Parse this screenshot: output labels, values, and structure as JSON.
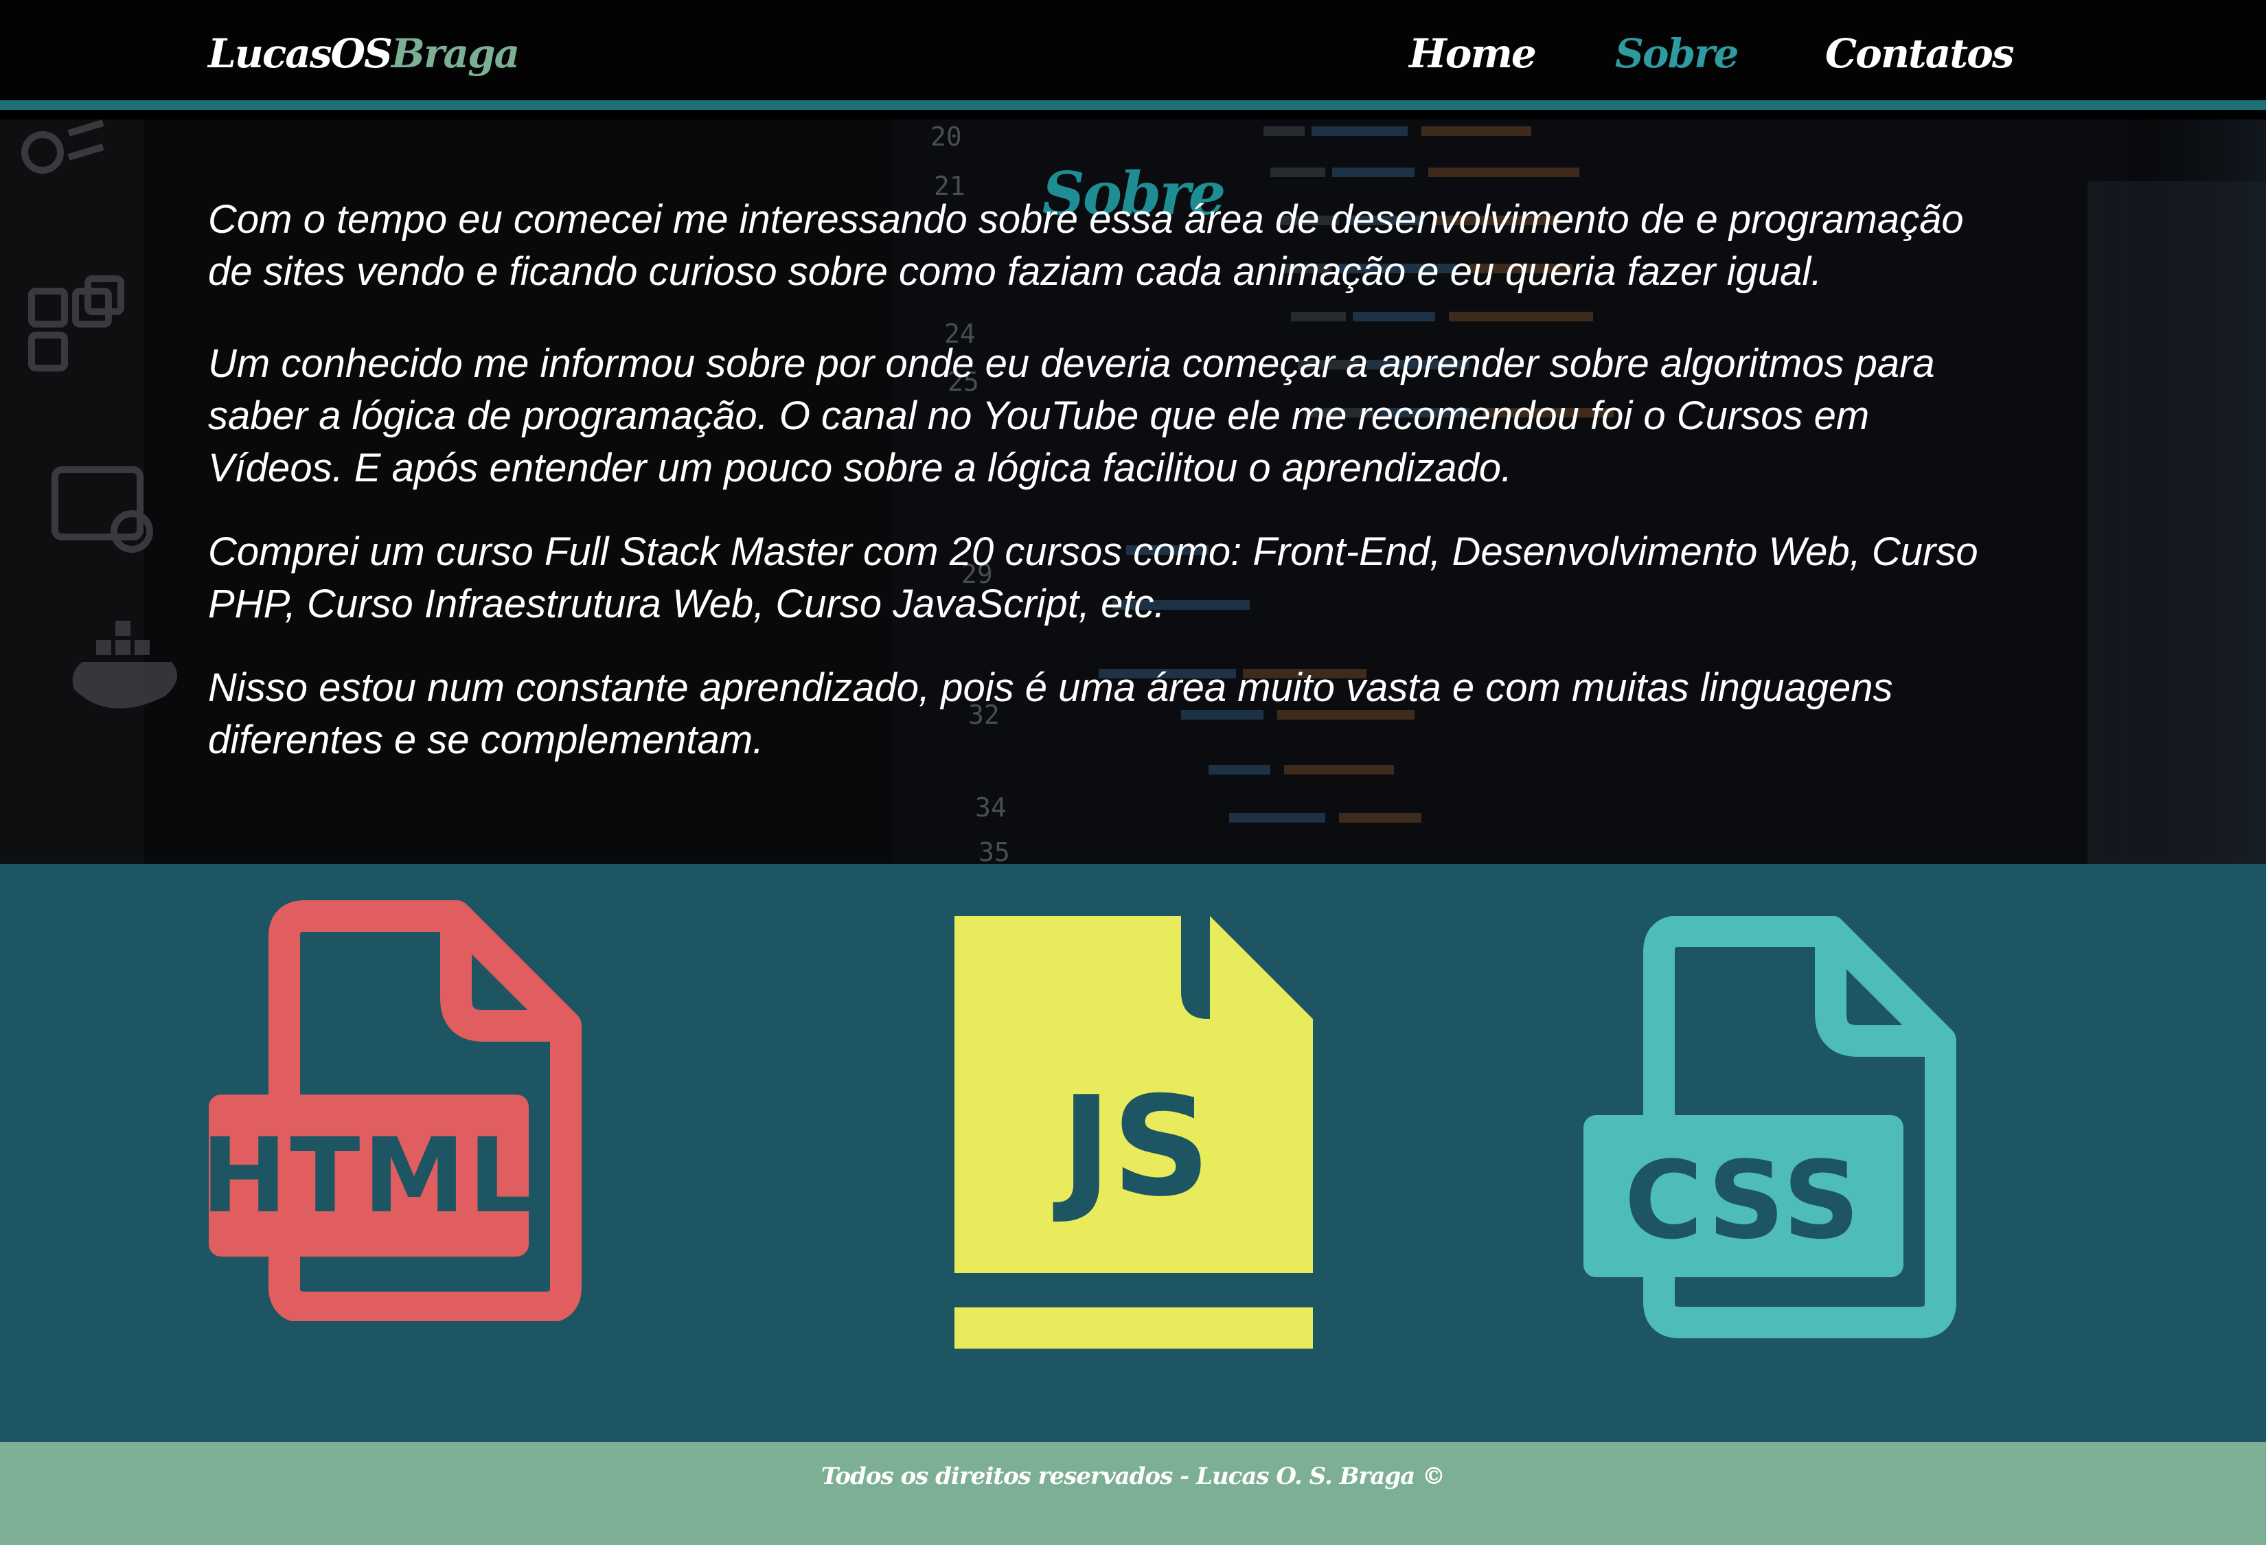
{
  "header": {
    "logo_main": "LucasOS",
    "logo_accent": "Braga",
    "nav": [
      {
        "label": "Home",
        "active": false
      },
      {
        "label": "Sobre",
        "active": true
      },
      {
        "label": "Contatos",
        "active": false
      }
    ]
  },
  "about": {
    "title": "Sobre",
    "paragraphs": [
      "Com o tempo eu comecei me interessando sobre essa área de desenvolvimento de e programação de sites vendo e ficando curioso sobre como faziam cada animação e eu queria fazer igual.",
      "Um conhecido me informou sobre por onde eu deveria começar a aprender sobre algoritmos para saber a lógica de programação. O canal no YouTube que ele me recomendou foi o Cursos em Vídeos. E após entender um pouco sobre a lógica facilitou o aprendizado.",
      "Comprei um curso Full Stack Master com 20 cursos como: Front-End, Desenvolvimento Web, Curso PHP, Curso Infraestrutura Web, Curso JavaScript, etc.",
      "Nisso estou num constante aprendizado, pois é uma área muito vasta e com muitas linguagens diferentes e se complementam."
    ],
    "background_line_numbers": [
      "20",
      "21",
      "24",
      "25",
      "29",
      "32",
      "34",
      "35"
    ]
  },
  "tech": {
    "html_label": "HTML",
    "js_label": "JS",
    "css_label": "CSS",
    "colors": {
      "html": "#e05e60",
      "js": "#e8ec5c",
      "css": "#4dbcba",
      "background": "#1e5562"
    }
  },
  "footer": {
    "text": "Todos os direitos reservados - Lucas O. S. Braga ©"
  },
  "colors": {
    "header_bg": "#030303",
    "accent_teal": "#1f8d94",
    "logo_accent": "#7caf93",
    "footer_bg": "#7caf93"
  }
}
